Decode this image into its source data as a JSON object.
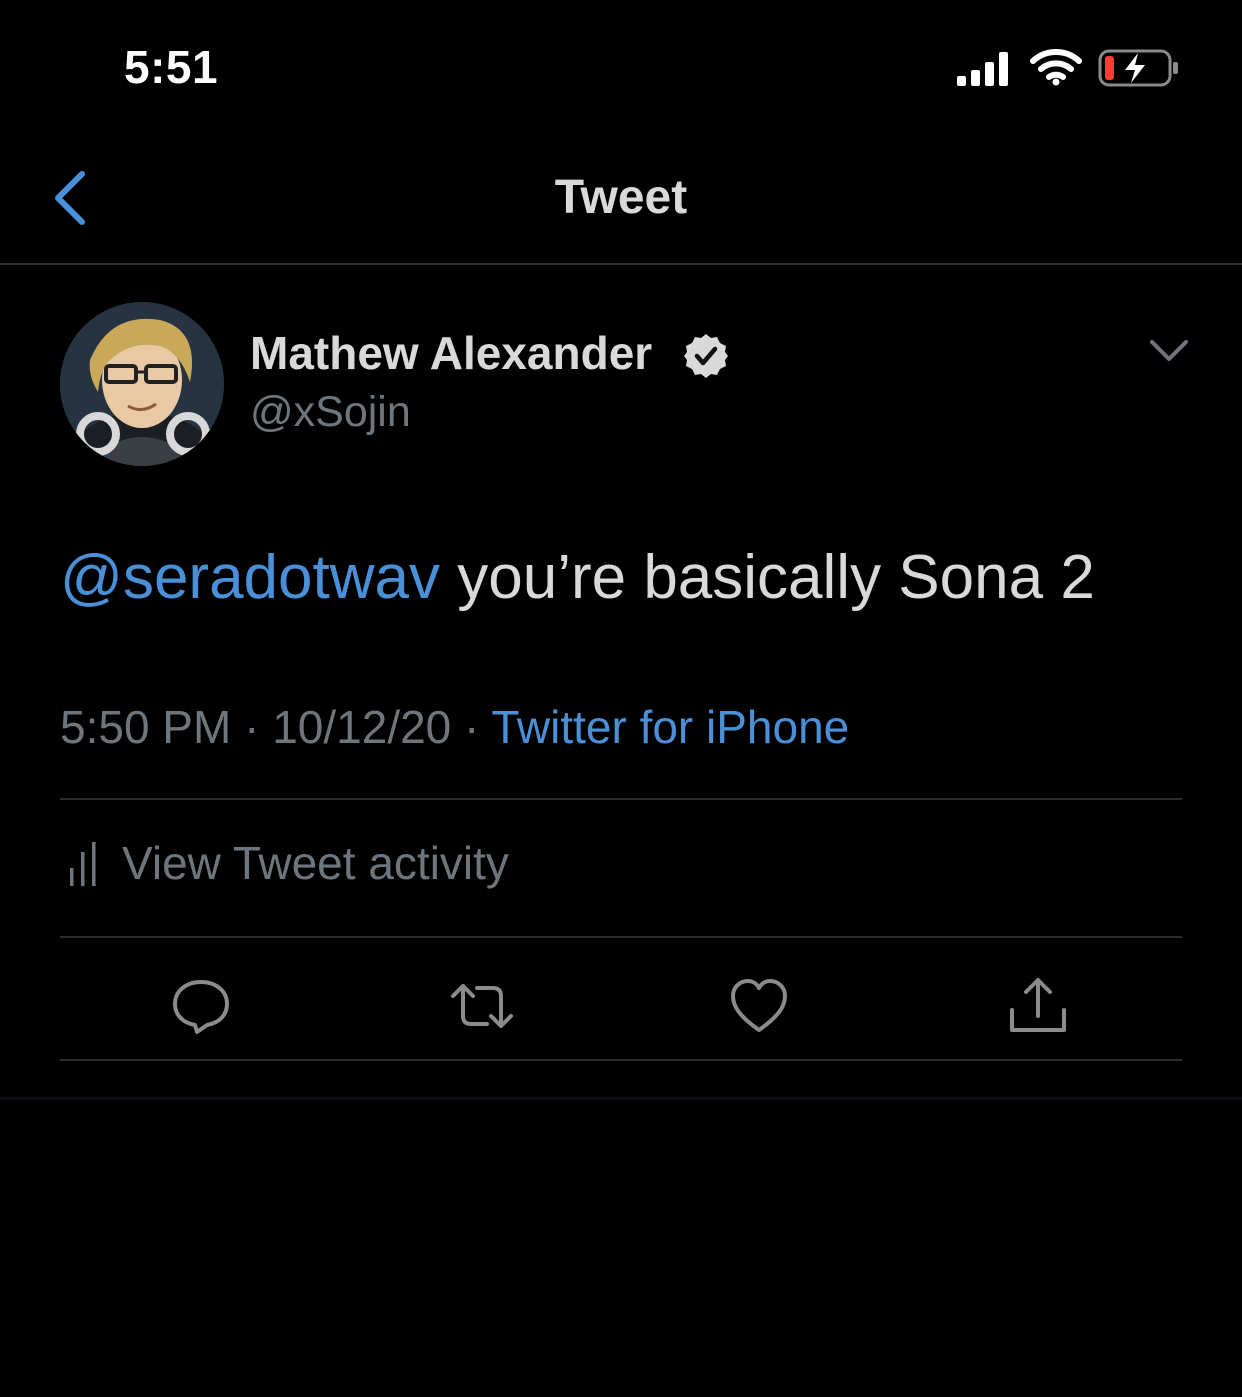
{
  "status_bar": {
    "time": "5:51",
    "signal_icon": "cellular-signal-icon",
    "wifi_icon": "wifi-icon",
    "battery_icon": "battery-charging-icon",
    "battery_low_color": "#ff3b30"
  },
  "nav": {
    "title": "Tweet",
    "back_icon": "chevron-left-icon",
    "accent": "#4a90d9"
  },
  "tweet": {
    "author_name": "Mathew Alexander",
    "handle": "@xSojin",
    "verified_icon": "verified-badge-icon",
    "menu_icon": "chevron-down-icon",
    "mention": "@seradotwav",
    "text": " you’re basically Sona 2",
    "time": "5:50 PM",
    "separator": " · ",
    "date": "10/12/20",
    "source": "Twitter for iPhone"
  },
  "activity": {
    "label": "View Tweet activity",
    "icon": "bar-chart-icon"
  },
  "actions": [
    {
      "name": "reply",
      "icon": "reply-icon"
    },
    {
      "name": "retweet",
      "icon": "retweet-icon"
    },
    {
      "name": "like",
      "icon": "heart-icon"
    },
    {
      "name": "share",
      "icon": "share-icon"
    }
  ],
  "colors": {
    "background": "#000000",
    "text": "#d9d9d9",
    "secondary": "#6e767d",
    "link": "#4a90d9",
    "divider": "#2a2d31"
  }
}
